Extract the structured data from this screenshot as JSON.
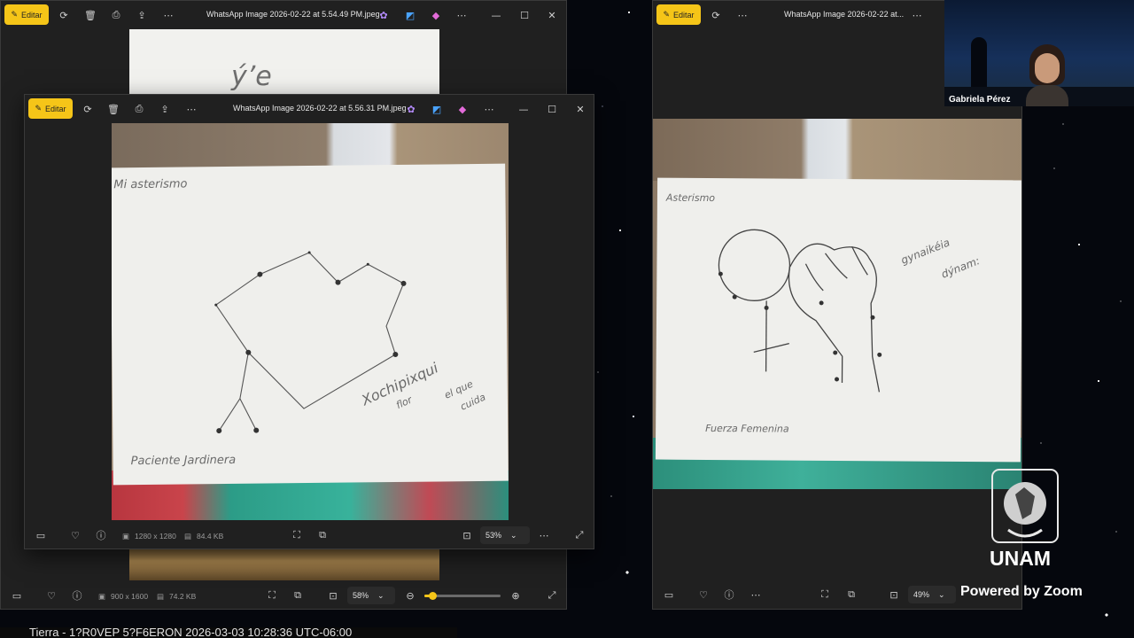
{
  "back_window": {
    "edit_label": "Editar",
    "title": "WhatsApp Image 2026-02-22 at 5.54.49 PM.jpeg",
    "handwriting_peek": "ý’e",
    "dimensions": "900 x 1600",
    "filesize": "74.2 KB",
    "zoom": "58%",
    "zoom_level": 0.1
  },
  "front_window": {
    "edit_label": "Editar",
    "title": "WhatsApp Image 2026-02-22 at 5.56.31 PM.jpeg",
    "dimensions": "1280 x 1280",
    "filesize": "84.4 KB",
    "zoom": "53%",
    "drawing": {
      "heading": "Mi  asterismo",
      "name": "Xochipixqui",
      "word_flor": "flor",
      "word_el_que": "el que",
      "word_cuida": "cuida",
      "caption": "Paciente  Jardinera"
    }
  },
  "right_window": {
    "edit_label": "Editar",
    "title": "WhatsApp Image 2026-02-22 at...",
    "zoom": "49%",
    "drawing": {
      "heading": "Asterismo",
      "word1": "gynaikéia",
      "word2": "dýnam:",
      "caption": "Fuerza  Femenina"
    }
  },
  "participant": {
    "name": "Gabriela Pérez"
  },
  "branding": {
    "unam": "UNAM",
    "powered": "Powered by Zoom"
  },
  "footer": {
    "ticker": "Tierra - 1?R0VEP 5?F6ERON 2026-03-03 10:28:36 UTC-06:00"
  },
  "colors": {
    "edit_button": "#f5c518",
    "window_bg": "#202020",
    "space_bg": "#05070d"
  }
}
